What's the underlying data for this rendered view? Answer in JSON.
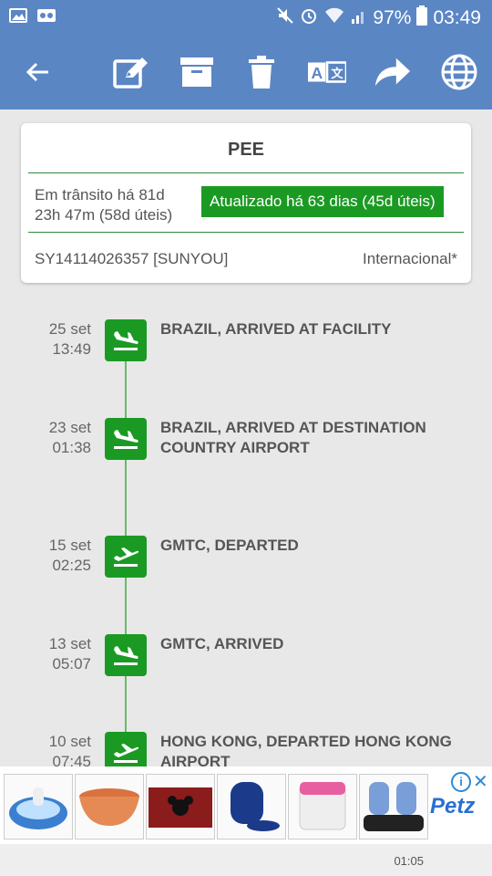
{
  "status_bar": {
    "battery": "97%",
    "time": "03:49"
  },
  "toolbar": {
    "actions": [
      "back-arrow-icon",
      "edit-icon",
      "archive-icon",
      "delete-icon",
      "translate-icon",
      "share-icon",
      "globe-icon"
    ]
  },
  "card": {
    "title": "PEE",
    "transit_line1": "Em trânsito há 81d",
    "transit_line2": "23h 47m (58d úteis)",
    "updated": "Atualizado há 63 dias (45d úteis)",
    "tracking": "SY14114026357 [SUNYOU]",
    "type": "Internacional*"
  },
  "events": [
    {
      "day": "25 set",
      "time": "13:49",
      "line1": "BRAZIL, ARRIVED AT FACILITY",
      "line2": "",
      "icon": "plane-landing-icon"
    },
    {
      "day": "23 set",
      "time": "01:38",
      "line1": "BRAZIL, ARRIVED AT DESTINATION",
      "line2": "COUNTRY AIRPORT",
      "icon": "plane-landing-icon"
    },
    {
      "day": "15 set",
      "time": "02:25",
      "line1": "GMTC, DEPARTED",
      "line2": "",
      "icon": "plane-takeoff-icon"
    },
    {
      "day": "13 set",
      "time": "05:07",
      "line1": "GMTC, ARRIVED",
      "line2": "",
      "icon": "plane-landing-icon"
    },
    {
      "day": "10 set",
      "time": "07:45",
      "line1": "HONG KONG, DEPARTED HONG KONG",
      "line2": "AIRPORT",
      "icon": "plane-takeoff-icon"
    }
  ],
  "ad": {
    "brand": "Petz",
    "info_icon": "info-icon",
    "close_icon": "close-icon"
  },
  "bottom": {
    "time": "01:05"
  },
  "colors": {
    "header": "#5b86c4",
    "green": "#1a9a23",
    "ad_blue": "#2a6fd0"
  }
}
